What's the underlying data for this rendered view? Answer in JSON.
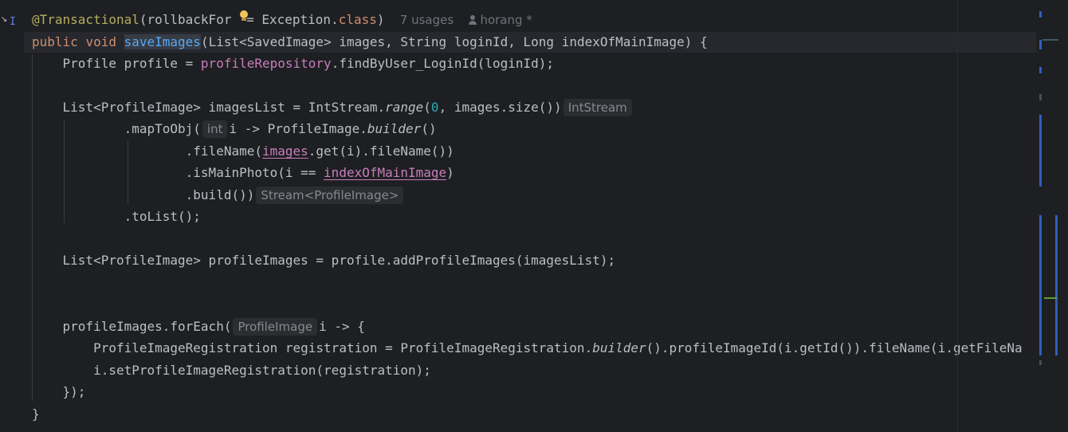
{
  "gutter": {
    "icon": "implementation-icon"
  },
  "code": {
    "line1": {
      "annotation": "@Transactional",
      "open": "(rollbackFor ",
      "eq": "=",
      "exc": " Exception.",
      "cls": "class",
      "close": ")",
      "usages": "7 usages",
      "author": "horang *"
    },
    "line2": {
      "kw_public": "public",
      "kw_void": "void",
      "method": "saveImages",
      "params": "(List<SavedImage> images, String loginId, Long indexOfMainImage) {"
    },
    "line3": {
      "a": "Profile profile = ",
      "field": "profileRepository",
      "b": ".findByUser_LoginId(loginId);"
    },
    "line5": {
      "a": "List<ProfileImage> imagesList = IntStream.",
      "range": "range",
      "b": "(",
      "zero": "0",
      "c": ", images.size())",
      "hint": "IntStream"
    },
    "line6": {
      "a": ".mapToObj(",
      "hint": "int",
      "b": "i -> ProfileImage.",
      "builder": "builder",
      "c": "()"
    },
    "line7": {
      "a": ".fileName(",
      "images": "images",
      "b": ".get(i).fileName())"
    },
    "line8": {
      "a": ".isMainPhoto(i == ",
      "idx": "indexOfMainImage",
      "b": ")"
    },
    "line9": {
      "a": ".build())",
      "hint": "Stream<ProfileImage>"
    },
    "line10": {
      "a": ".toList();"
    },
    "line12": {
      "a": "List<ProfileImage> profileImages = profile.addProfileImages(imagesList);"
    },
    "line15": {
      "a": "profileImages.forEach(",
      "hint": "ProfileImage",
      "b": "i -> {"
    },
    "line16": {
      "a": "ProfileImageRegistration registration = ProfileImageRegistration.",
      "builder": "builder",
      "b": "().profileImageId(i.getId()).fileName(i.getFileNa"
    },
    "line17": {
      "a": "i.setProfileImageRegistration(registration);"
    },
    "line18": {
      "a": "});"
    },
    "line19": {
      "a": "}"
    }
  },
  "colors": {
    "background": "#1e1f22",
    "keyword": "#cf8e6d",
    "annotation": "#b3ae60",
    "method": "#56a8f5",
    "field": "#c77dbb",
    "number": "#2aacb8",
    "text": "#bcbec4"
  }
}
